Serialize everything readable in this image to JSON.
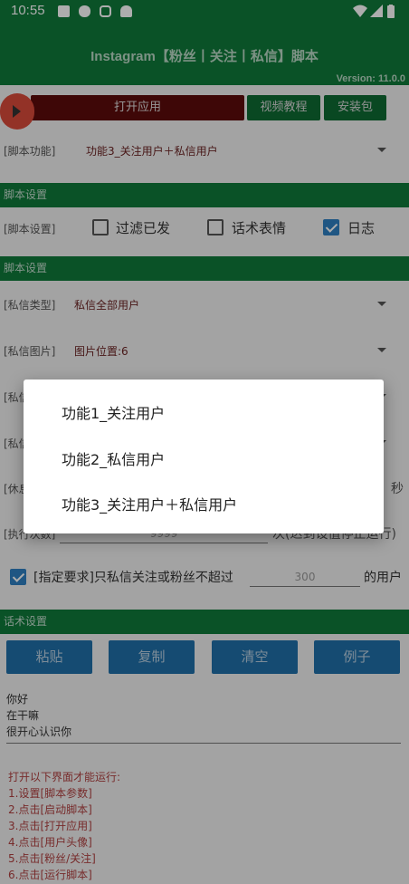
{
  "status_bar": {
    "time": "10:55",
    "left_icons": [
      "image-icon",
      "twitter-icon",
      "instagram-icon",
      "android-debug-icon"
    ],
    "right_icons": [
      "wifi-icon",
      "signal-icon",
      "battery-icon"
    ]
  },
  "header": {
    "title": "Instagram【粉丝丨关注丨私信】脚本",
    "version": "Version: 11.0.0"
  },
  "top_buttons": {
    "open_app": "打开应用",
    "video_tutorial": "视频教程",
    "install_package": "安装包"
  },
  "script_function": {
    "label": "[脚本功能]",
    "value": "功能3_关注用户＋私信用户"
  },
  "script_settings_section": "脚本设置",
  "script_settings_row": {
    "label": "[脚本设置]",
    "options": [
      {
        "label": "过滤已发",
        "checked": false
      },
      {
        "label": "话术表情",
        "checked": false
      },
      {
        "label": "日志",
        "checked": true
      }
    ]
  },
  "script_settings_section2": "脚本设置",
  "dm_type": {
    "label": "[私信类型]",
    "value": "私信全部用户"
  },
  "dm_image": {
    "label": "[私信图片]",
    "value": "图片位置:6"
  },
  "partial_rows": {
    "row1_label": "[私信",
    "row2_label": "[私信",
    "rest_label": "[休息",
    "rest_unit": "秒",
    "exec_label": "[执行次数]",
    "exec_value": "9999",
    "exec_suffix": "次(达到设值停止运行)"
  },
  "requirement": {
    "checked": true,
    "text": "[指定要求]只私信关注或粉丝不超过",
    "value": "300",
    "suffix": "的用户"
  },
  "speech_section": "话术设置",
  "speech_buttons": [
    "粘贴",
    "复制",
    "清空",
    "例子"
  ],
  "message_lines": [
    "你好",
    "在干嘛",
    "很开心认识你"
  ],
  "instructions": [
    "打开以下界面才能运行:",
    "1.设置[脚本参数]",
    "2.点击[启动脚本]",
    "3.点击[打开应用]",
    "4.点击[用户头像]",
    "5.点击[粉丝/关注]",
    "6.点击[运行脚本]"
  ],
  "dialog": {
    "options": [
      "功能1_关注用户",
      "功能2_私信用户",
      "功能3_关注用户＋私信用户"
    ]
  }
}
